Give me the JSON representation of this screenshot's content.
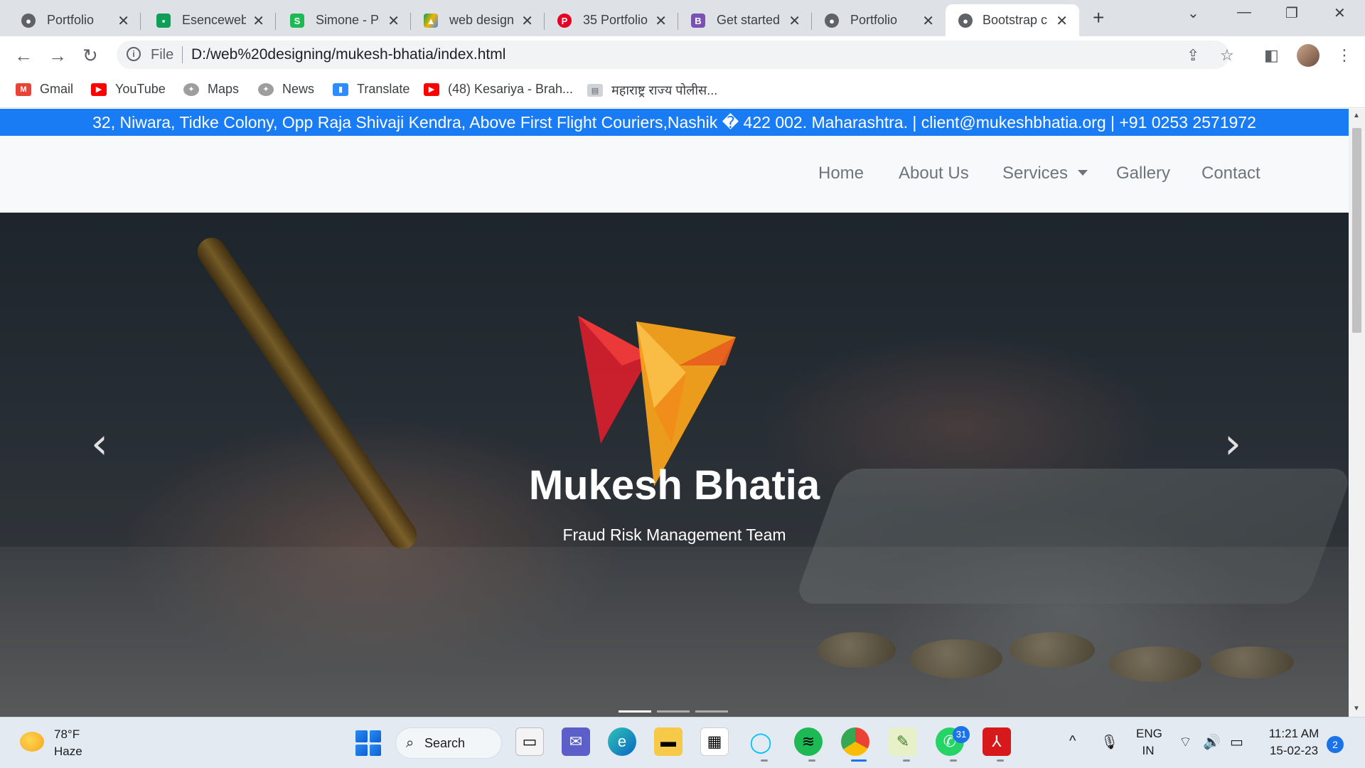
{
  "tabs": [
    {
      "title": "Portfolio",
      "icon": "globe-icon",
      "color": "#5f6368"
    },
    {
      "title": "Esenceweb",
      "icon": "chat-icon",
      "color": "#0f9d58"
    },
    {
      "title": "Simone - Pc",
      "icon": "s-logo-icon",
      "color": "#1db954"
    },
    {
      "title": "web design",
      "icon": "drive-icon",
      "color": "#f4b400"
    },
    {
      "title": "35 Portfolio",
      "icon": "pinterest-icon",
      "color": "#e60023"
    },
    {
      "title": "Get started",
      "icon": "bootstrap-icon",
      "color": "#7952b3"
    },
    {
      "title": "Portfolio",
      "icon": "globe-icon",
      "color": "#5f6368"
    },
    {
      "title": "Bootstrap c",
      "icon": "globe-icon",
      "color": "#5f6368"
    }
  ],
  "address": {
    "scheme_label": "File",
    "url": "D:/web%20designing/mukesh-bhatia/index.html"
  },
  "bookmarks": [
    {
      "label": "Gmail",
      "icon": "gmail-icon",
      "color": "#ea4335"
    },
    {
      "label": "YouTube",
      "icon": "youtube-icon",
      "color": "#ff0000"
    },
    {
      "label": "Maps",
      "icon": "emblem-icon",
      "color": "#7a7a7a"
    },
    {
      "label": "News",
      "icon": "emblem-icon",
      "color": "#7a7a7a"
    },
    {
      "label": "Translate",
      "icon": "zoom-icon",
      "color": "#2d8cff"
    },
    {
      "label": "(48) Kesariya - Brah...",
      "icon": "youtube-icon",
      "color": "#ff0000"
    },
    {
      "label": "महाराष्ट्र राज्य पोलीस...",
      "icon": "page-icon",
      "color": "#9aa0a6"
    }
  ],
  "site": {
    "topbar_text": "32, Niwara, Tidke Colony, Opp Raja Shivaji Kendra, Above First Flight Couriers,Nashik � 422 002. Maharashtra. | client@mukeshbhatia.org | +91 0253 2571972",
    "nav": {
      "home": "Home",
      "about": "About Us",
      "services": "Services",
      "gallery": "Gallery",
      "contact": "Contact"
    },
    "hero": {
      "title": "Mukesh Bhatia",
      "subtitle": "Fraud Risk Management Team",
      "active_slide": 1,
      "slide_count": 3
    },
    "accent_color": "#1a7cf5"
  },
  "taskbar": {
    "weather_temp": "78°F",
    "weather_desc": "Haze",
    "search_label": "Search",
    "whatsapp_badge": "31",
    "lang_line1": "ENG",
    "lang_line2": "IN",
    "time": "11:21 AM",
    "date": "15-02-23",
    "notification_count": "2"
  }
}
